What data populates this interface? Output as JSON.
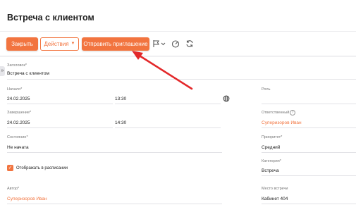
{
  "header": {
    "title": "Встреча с клиентом"
  },
  "toolbar": {
    "close_label": "Закрыть",
    "actions_label": "Действия",
    "invite_label": "Отправить приглашение",
    "icons": [
      "flag-icon",
      "chevron-down-icon",
      "timer-icon",
      "refresh-icon"
    ]
  },
  "form": {
    "subject": {
      "label": "Заголовок*",
      "value": "Встреча с клиентом"
    },
    "start": {
      "label": "Начало*",
      "date": "24.02.2025",
      "time": "13:30"
    },
    "end": {
      "label": "Завершение*",
      "date": "24.02.2025",
      "time": "14:30"
    },
    "status": {
      "label": "Состояние*",
      "value": "Не начата"
    },
    "show_in_schedule": {
      "label": "Отображать в расписании",
      "checked": true
    },
    "author": {
      "label": "Автор*",
      "value": "Суперизоров Иван"
    },
    "role": {
      "label": "Роль",
      "value": ""
    },
    "owner": {
      "label": "Ответственный",
      "value": "Суперизоров Иван"
    },
    "priority": {
      "label": "Приоритет*",
      "value": "Средний"
    },
    "category": {
      "label": "Категория*",
      "value": "Встреча"
    },
    "location": {
      "label": "Место встречи",
      "value": "Кабинет 404"
    }
  },
  "colors": {
    "accent": "#f2743f",
    "arrow": "#e3282a"
  }
}
